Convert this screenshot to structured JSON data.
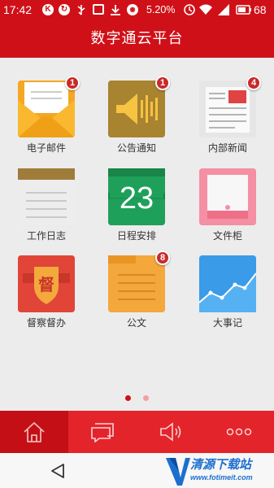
{
  "status_bar": {
    "time": "17:42",
    "notif_k": "K",
    "battery_percent_text": "5.20%",
    "battery_level": "68"
  },
  "header": {
    "title": "数字通云平台"
  },
  "apps": [
    {
      "label": "电子邮件",
      "icon": "envelope-icon",
      "badge": "1"
    },
    {
      "label": "公告通知",
      "icon": "announcement-icon",
      "badge": "1"
    },
    {
      "label": "内部新闻",
      "icon": "newspaper-icon",
      "badge": "4"
    },
    {
      "label": "工作日志",
      "icon": "notebook-icon",
      "badge": ""
    },
    {
      "label": "日程安排",
      "icon": "calendar-icon",
      "badge": "",
      "calendar_day": "23"
    },
    {
      "label": "文件柜",
      "icon": "file-cabinet-icon",
      "badge": ""
    },
    {
      "label": "督察督办",
      "icon": "supervision-icon",
      "badge": "",
      "glyph": "督"
    },
    {
      "label": "公文",
      "icon": "folder-icon",
      "badge": "8"
    },
    {
      "label": "大事记",
      "icon": "line-chart-icon",
      "badge": ""
    }
  ],
  "pager": {
    "pages": 2,
    "active_index": 0
  },
  "tabs": [
    {
      "name": "home",
      "icon": "home-icon",
      "active": true
    },
    {
      "name": "message",
      "icon": "chat-icon",
      "active": false
    },
    {
      "name": "broadcast",
      "icon": "speaker-icon",
      "active": false
    },
    {
      "name": "more",
      "icon": "more-icon",
      "active": false
    }
  ],
  "watermark": {
    "title": "清源下载站",
    "url": "www.fotimeit.com"
  },
  "colors": {
    "brand_red": "#d01018",
    "tab_red": "#e4242b",
    "tab_active": "#c40f16",
    "badge_red": "#c92a2a",
    "page_bg": "#ececec"
  }
}
